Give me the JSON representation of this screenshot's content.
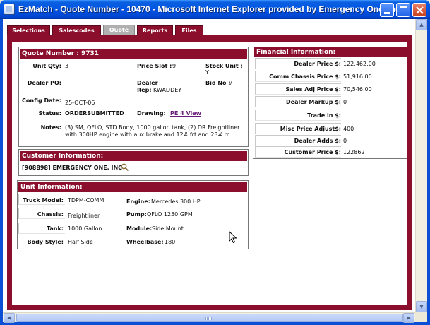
{
  "window": {
    "title": "EzMatch - Quote Number - 10470 - Microsoft Internet Explorer provided by Emergency One, Inc."
  },
  "tabs": [
    {
      "label": "Selections"
    },
    {
      "label": "Salescodes"
    },
    {
      "label": "Quote"
    },
    {
      "label": "Reports"
    },
    {
      "label": "Files"
    }
  ],
  "quote": {
    "header": "Quote Number : 9731",
    "unit_qty_label": "Unit Qty:",
    "unit_qty": "3",
    "price_slot_label": "Price Slot :",
    "price_slot": "9",
    "stock_unit_label": "Stock Unit :",
    "stock_unit": "Y",
    "dealer_po_label": "Dealer PO:",
    "dealer_po": "",
    "dealer_rep_label_1": "Dealer",
    "dealer_rep_label_2": "Rep:",
    "dealer_rep": "KWADDEY",
    "bid_no_label": "Bid No :",
    "bid_no": "/",
    "config_date_label": "Config Date:",
    "config_date": "25-OCT-06",
    "status_label": "Status:",
    "status": "ORDERSUBMITTED",
    "drawing_label": "Drawing:",
    "drawing_link": "PE 4 View",
    "notes_label": "Notes:",
    "notes": "(3) SM, QFLO, STD Body, 1000 gallon tank, (2) DR Freightliner with 300HP engine with aux brake and 12# frt and 23# rr."
  },
  "customer": {
    "header": "Customer Information:",
    "value": "[908898] EMERGENCY ONE, INC"
  },
  "unit": {
    "header": "Unit Information:",
    "truck_model_label": "Truck Model:",
    "truck_model": "TDPM-COMM",
    "engine_label": "Engine:",
    "engine": "Mercedes 300 HP",
    "chassis_label": "Chassis:",
    "chassis": "Freightliner",
    "pump_label": "Pump:",
    "pump": "QFLO 1250 GPM",
    "tank_label": "Tank:",
    "tank": "1000 Gallon",
    "module_label": "Module:",
    "module": "Side Mount",
    "body_style_label": "Body Style:",
    "body_style": "Half Side",
    "wheelbase_label": "Wheelbase:",
    "wheelbase": "180"
  },
  "financial": {
    "header": "Financial Information:",
    "rows": [
      {
        "label": "Dealer Price $:",
        "value": "122,462.00"
      },
      {
        "label": "Comm Chassis Price $:",
        "value": "51,916.00"
      },
      {
        "label": "Sales Adj Price $:",
        "value": "70,546.00"
      },
      {
        "label": "Dealer Markup $:",
        "value": "0"
      },
      {
        "label": "Trade in $:",
        "value": ""
      },
      {
        "label": "Misc Price Adjust$:",
        "value": "400"
      },
      {
        "label": "Dealer Adds $:",
        "value": "0"
      },
      {
        "label": "Customer Price $:",
        "value": "122862"
      }
    ]
  },
  "colors": {
    "accent": "#8b0e2d",
    "titlebar": "#0055e5",
    "tab_active": "#b0b0b0"
  }
}
